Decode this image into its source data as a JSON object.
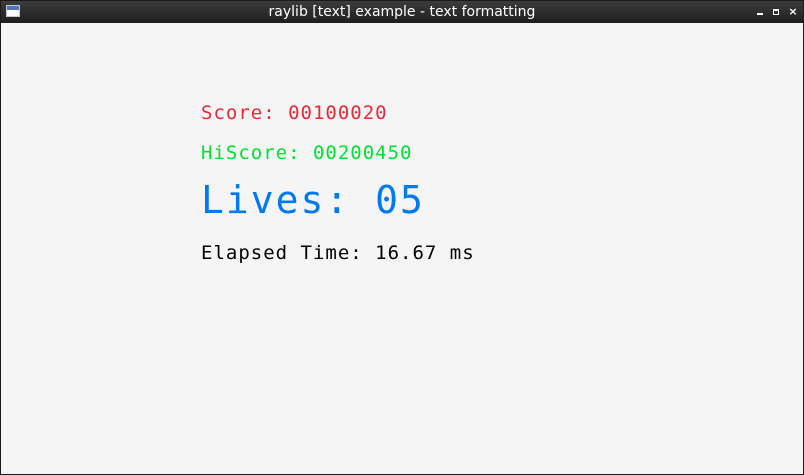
{
  "window": {
    "title": "raylib [text] example - text formatting",
    "controls": {
      "minimize_icon": "minimize-icon",
      "maximize_icon": "maximize-icon",
      "close_icon": "close-icon",
      "close_glyph": "×"
    }
  },
  "content": {
    "score": {
      "text": "Score: 00100020",
      "color": "#e62937"
    },
    "hiscore": {
      "text": "HiScore: 00200450",
      "color": "#00e430"
    },
    "lives": {
      "text": "Lives: 05",
      "color": "#0079f1"
    },
    "elapsed": {
      "text": "Elapsed Time: 16.67 ms",
      "color": "#000000"
    }
  },
  "colors": {
    "background": "#f5f5f5",
    "titlebar": "#2b2b2b"
  }
}
